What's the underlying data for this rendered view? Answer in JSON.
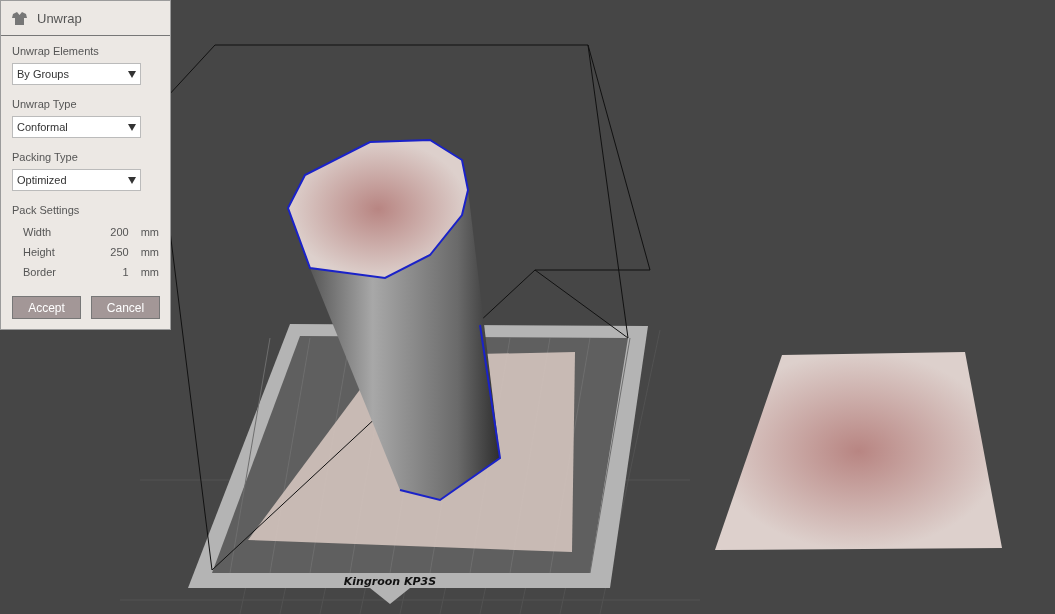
{
  "panel": {
    "title": "Unwrap",
    "dropdowns": [
      {
        "label": "Unwrap Elements",
        "value": "By Groups"
      },
      {
        "label": "Unwrap Type",
        "value": "Conformal"
      },
      {
        "label": "Packing Type",
        "value": "Optimized"
      }
    ],
    "pack_settings": {
      "label": "Pack Settings",
      "rows": [
        {
          "name": "Width",
          "value": "200",
          "unit": "mm"
        },
        {
          "name": "Height",
          "value": "250",
          "unit": "mm"
        },
        {
          "name": "Border",
          "value": "1",
          "unit": "mm"
        }
      ]
    },
    "buttons": [
      "Accept",
      "Cancel"
    ]
  },
  "viewport": {
    "printer_label": "Kingroon KP3S"
  }
}
